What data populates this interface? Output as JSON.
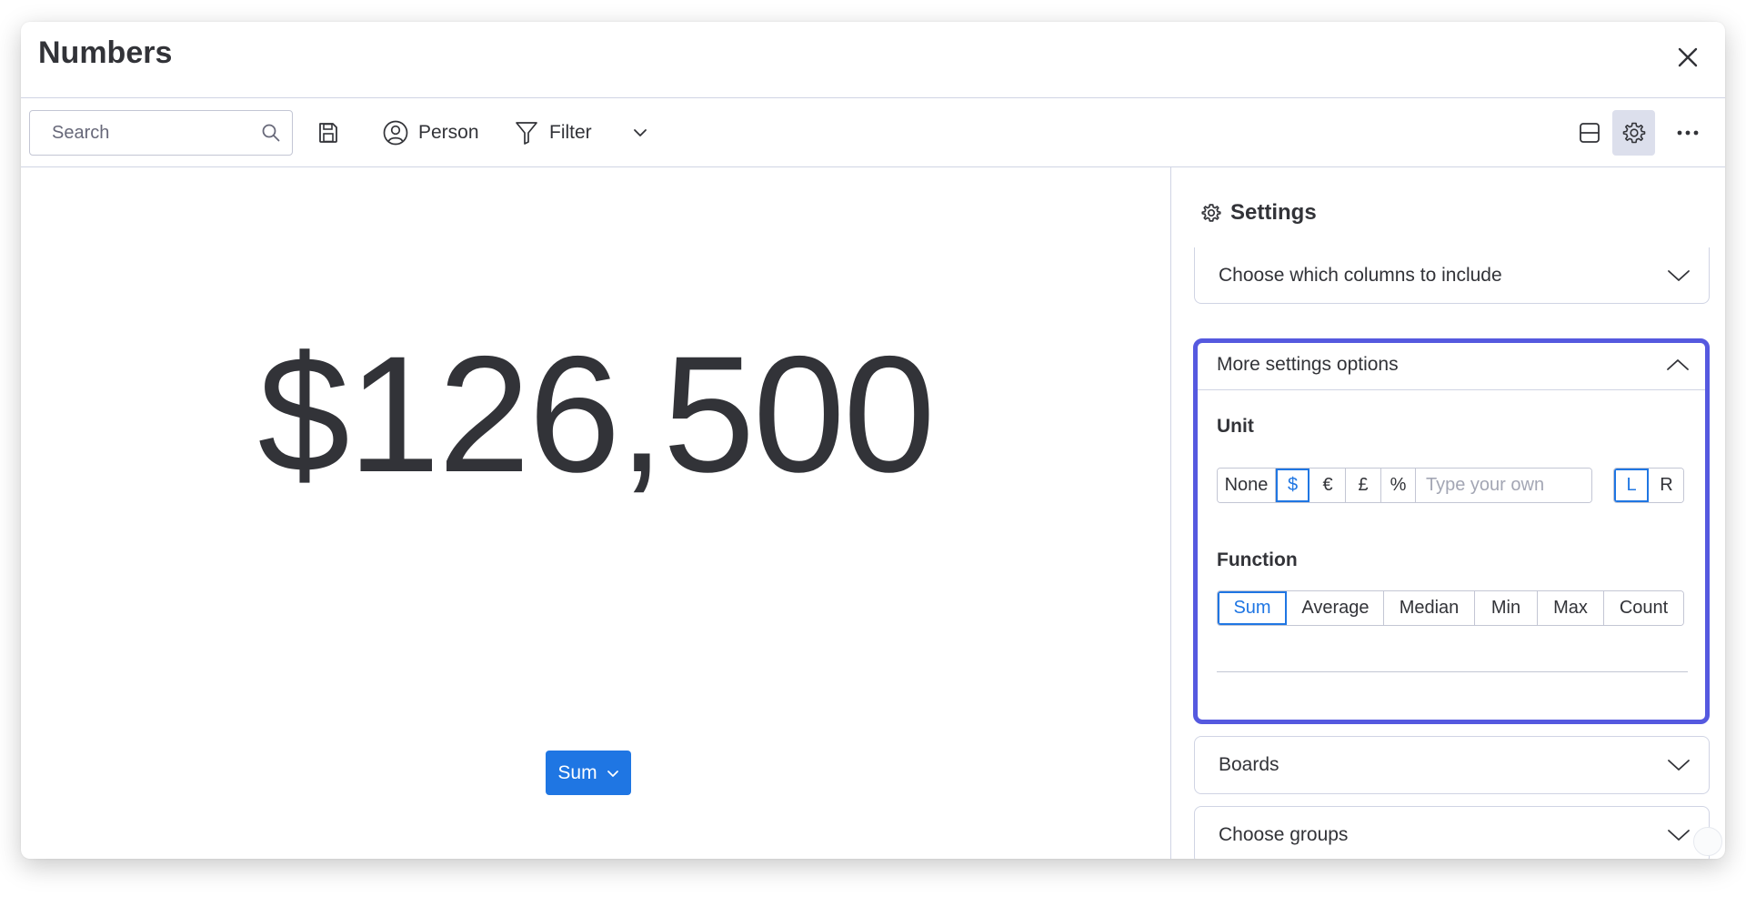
{
  "window": {
    "title": "Numbers"
  },
  "toolbar": {
    "search_placeholder": "Search",
    "person_label": "Person",
    "filter_label": "Filter"
  },
  "main": {
    "value": "$126,500",
    "function_button_label": "Sum"
  },
  "settings": {
    "header": "Settings",
    "columns_label": "Choose which columns to include",
    "more_settings_label": "More settings options",
    "unit": {
      "title": "Unit",
      "options": [
        "None",
        "$",
        "€",
        "£",
        "%"
      ],
      "selected": "$",
      "custom_placeholder": "Type your own",
      "direction_options": [
        "L",
        "R"
      ],
      "direction_selected": "L"
    },
    "function": {
      "title": "Function",
      "options": [
        "Sum",
        "Average",
        "Median",
        "Min",
        "Max",
        "Count"
      ],
      "selected": "Sum"
    },
    "boards_label": "Boards",
    "groups_label": "Choose groups"
  },
  "colors": {
    "accent": "#1f76e3",
    "focus_border": "#5559df",
    "text": "#323338",
    "border": "#d0d4e4",
    "active_icon_bg": "#dcdfec"
  },
  "icons": {
    "close": "close-icon",
    "search": "search-icon",
    "save": "save-icon",
    "person": "person-icon",
    "filter": "filter-icon",
    "chevron": "chevron-down-icon",
    "layout": "layout-icon",
    "gear": "gear-icon",
    "more": "more-icon"
  }
}
